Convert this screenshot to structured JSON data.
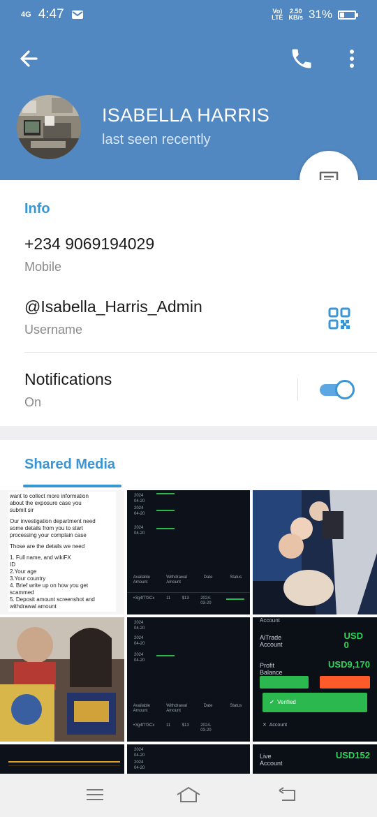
{
  "status_bar": {
    "signal": "4G",
    "time": "4:47",
    "volte_top": "Vo)",
    "volte_bottom": "LTE",
    "speed_top": "2.50",
    "speed_bottom": "KB/s",
    "battery_text": "31%",
    "battery_level": 0.31
  },
  "header": {
    "name": "ISABELLA HARRIS",
    "status": "last seen recently"
  },
  "info": {
    "title": "Info",
    "phone": "+234 9069194029",
    "phone_label": "Mobile",
    "username": "@Isabella_Harris_Admin",
    "username_label": "Username",
    "notifications": "Notifications",
    "notifications_state": "On",
    "notifications_enabled": true
  },
  "media": {
    "title": "Shared Media",
    "doc_lines": [
      "want to collect more information",
      "about the exposure case you",
      "submit sir",
      "",
      "Our investigation department need",
      "some details from you to start",
      "processing your complain case",
      "",
      "Those are the details we need",
      "",
      "1. Full name, and wikiFX",
      "ID",
      "2.Your age",
      "3.Your country",
      "4. Brief write up on how you get",
      "scammed",
      "5. Deposit amount screenshot and",
      "withdrawal amount"
    ],
    "table_dates": [
      "2024",
      "04-20",
      "2024",
      "04-20",
      "2024",
      "04-20"
    ],
    "table_headers": [
      "Available Amount",
      "Withdrawal Amount",
      "Date",
      "Status"
    ],
    "table_row": [
      "+3g4fTf3Cx",
      "11",
      "$13",
      "2024-03-20"
    ],
    "fin_account": "Account",
    "fin_aitrade": "AiTrade",
    "fin_aitrade2": "Account",
    "fin_usd": "USD",
    "fin_zero": "0",
    "fin_profit": "Profit",
    "fin_balance": "Balance",
    "fin_profit_value": "USD9,170",
    "fin_verified": "Verified",
    "fin_live": "Live",
    "fin_live2": "Account",
    "fin_live_value": "USD152"
  },
  "icons": {
    "back": "arrow-left",
    "call": "phone",
    "more": "dots-vertical",
    "message": "chat-bubble",
    "qr": "qr-code",
    "nav_menu": "menu",
    "nav_home": "home",
    "nav_back": "back"
  },
  "colors": {
    "header": "#5288c1",
    "accent": "#3a95d5"
  }
}
